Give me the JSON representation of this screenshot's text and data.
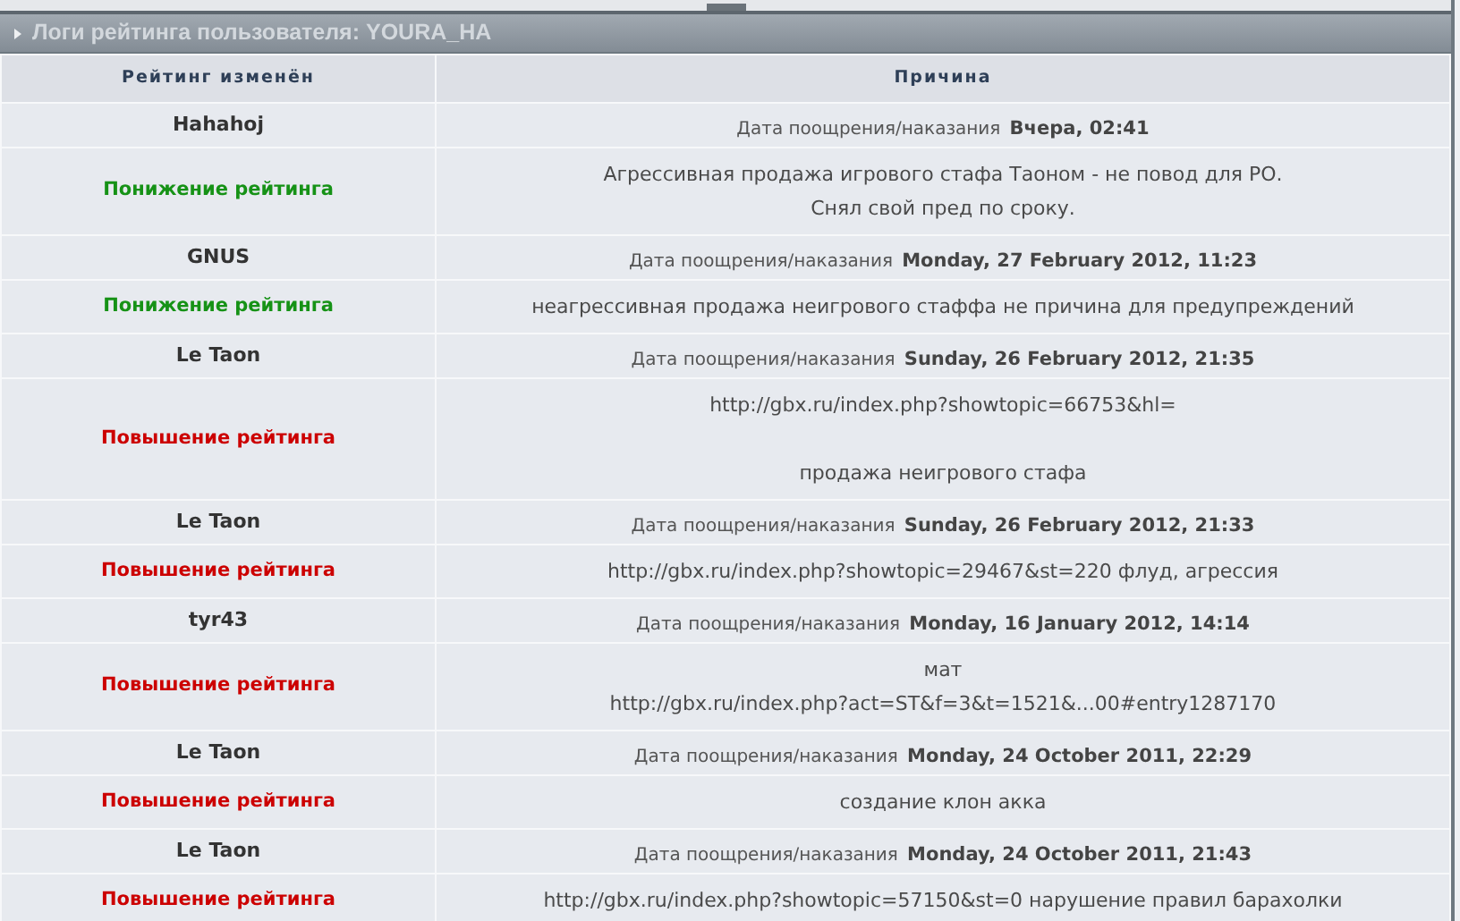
{
  "panel": {
    "title": "Логи рейтинга пользователя: YOURA_HA"
  },
  "table": {
    "columns": [
      "Рейтинг изменён",
      "Причина"
    ],
    "entries": [
      {
        "user": "Hahahoj",
        "date_label": "Дата поощрения/наказания",
        "date": "Вчера, 02:41",
        "change": "Понижение рейтинга",
        "kind": "down",
        "reason": [
          [
            "Агрессивная продажа игрового стафа Таоном - не повод для РО.",
            "Снял свой пред по сроку."
          ]
        ]
      },
      {
        "user": "GNUS",
        "date_label": "Дата поощрения/наказания",
        "date": "Monday, 27 February 2012, 11:23",
        "change": "Понижение рейтинга",
        "kind": "down",
        "reason": [
          [
            "неагрессивная продажа неигрового стаффа не причина для предупреждений"
          ]
        ]
      },
      {
        "user": "Le Taon",
        "date_label": "Дата поощрения/наказания",
        "date": "Sunday, 26 February 2012, 21:35",
        "change": "Повышение рейтинга",
        "kind": "up",
        "reason": [
          [
            "http://gbx.ru/index.php?showtopic=66753&hl="
          ],
          [
            "продажа неигрового стафа"
          ]
        ]
      },
      {
        "user": "Le Taon",
        "date_label": "Дата поощрения/наказания",
        "date": "Sunday, 26 February 2012, 21:33",
        "change": "Повышение рейтинга",
        "kind": "up",
        "reason": [
          [
            "http://gbx.ru/index.php?showtopic=29467&st=220 флуд, агрессия"
          ]
        ]
      },
      {
        "user": "tyr43",
        "date_label": "Дата поощрения/наказания",
        "date": "Monday, 16 January 2012, 14:14",
        "change": "Повышение рейтинга",
        "kind": "up",
        "reason": [
          [
            "мат",
            "http://gbx.ru/index.php?act=ST&f=3&t=1521&...00#entry1287170"
          ]
        ]
      },
      {
        "user": "Le Taon",
        "date_label": "Дата поощрения/наказания",
        "date": "Monday, 24 October 2011, 22:29",
        "change": "Повышение рейтинга",
        "kind": "up",
        "reason": [
          [
            "создание клон акка"
          ]
        ]
      },
      {
        "user": "Le Taon",
        "date_label": "Дата поощрения/наказания",
        "date": "Monday, 24 October 2011, 21:43",
        "change": "Повышение рейтинга",
        "kind": "up",
        "reason": [
          [
            "http://gbx.ru/index.php?showtopic=57150&st=0 нарушение правил барахолки"
          ]
        ]
      }
    ]
  }
}
